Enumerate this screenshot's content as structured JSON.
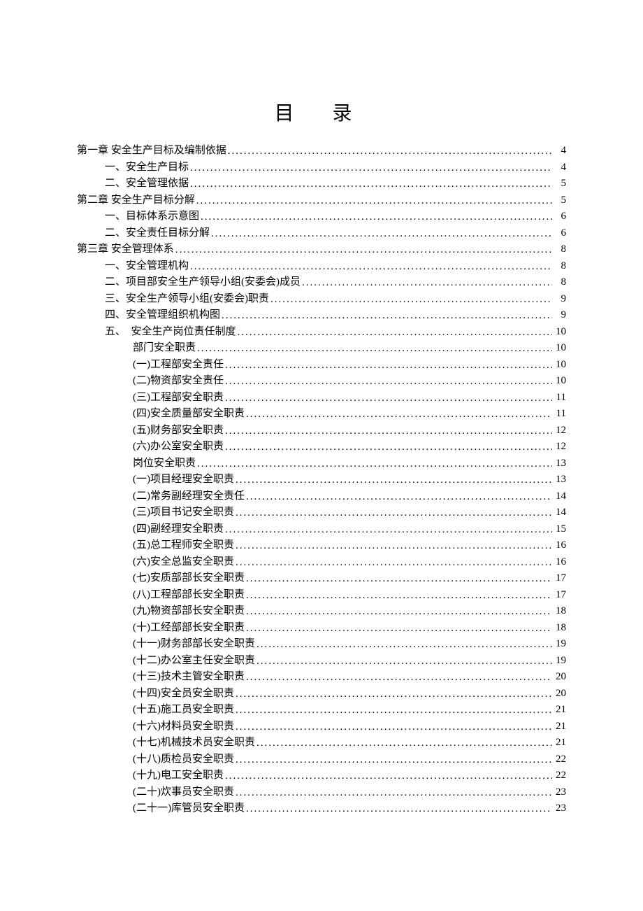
{
  "title": "目 录",
  "toc": [
    {
      "level": 0,
      "label": "第一章 安全生产目标及编制依据",
      "page": "4"
    },
    {
      "level": 1,
      "label": "一、安全生产目标",
      "page": "4"
    },
    {
      "level": 1,
      "label": "二、安全管理依据",
      "page": "5"
    },
    {
      "level": 0,
      "label": "第二章 安全生产目标分解",
      "page": "5"
    },
    {
      "level": 1,
      "label": "一、目标体系示意图",
      "page": "6"
    },
    {
      "level": 1,
      "label": "二、安全责任目标分解",
      "page": "6"
    },
    {
      "level": 0,
      "label": "第三章 安全管理体系",
      "page": "8"
    },
    {
      "level": 1,
      "label": "一、安全管理机构",
      "page": "8"
    },
    {
      "level": 1,
      "label": "二、项目部安全生产领导小组(安委会)成员",
      "page": "8"
    },
    {
      "level": 1,
      "label": "三、安全生产领导小组(安委会)职责",
      "page": "9"
    },
    {
      "level": 1,
      "label": "四、安全管理组织机构图",
      "page": "9"
    },
    {
      "level": 1,
      "label": "五、　安全生产岗位责任制度",
      "page": "10"
    },
    {
      "level": 2,
      "label": "部门安全职责",
      "page": "10"
    },
    {
      "level": 2,
      "label": "(一)工程部安全责任",
      "page": "10"
    },
    {
      "level": 2,
      "label": "(二)物资部安全责任",
      "page": "10"
    },
    {
      "level": 2,
      "label": "(三)工程部安全职责",
      "page": "11"
    },
    {
      "level": 2,
      "label": "(四)安全质量部安全职责",
      "page": "11"
    },
    {
      "level": 2,
      "label": "(五)财务部安全职责",
      "page": "12"
    },
    {
      "level": 2,
      "label": "(六)办公室安全职责",
      "page": "12"
    },
    {
      "level": 2,
      "label": "岗位安全职责",
      "page": "13"
    },
    {
      "level": 2,
      "label": "(一)项目经理安全职责",
      "page": "13"
    },
    {
      "level": 2,
      "label": "(二)常务副经理安全责任",
      "page": "14"
    },
    {
      "level": 2,
      "label": "(三)项目书记安全职责",
      "page": "14"
    },
    {
      "level": 2,
      "label": "(四)副经理安全职责",
      "page": "15"
    },
    {
      "level": 2,
      "label": "(五)总工程师安全职责",
      "page": "16"
    },
    {
      "level": 2,
      "label": "(六)安全总监安全职责",
      "page": "16"
    },
    {
      "level": 2,
      "label": "(七)安质部部长安全职责",
      "page": "17"
    },
    {
      "level": 2,
      "label": "(八)工程部部长安全职责",
      "page": "17"
    },
    {
      "level": 2,
      "label": "(九)物资部部长安全职责",
      "page": "18"
    },
    {
      "level": 2,
      "label": "(十)工经部部长安全职责",
      "page": "18"
    },
    {
      "level": 2,
      "label": "(十一)财务部部长安全职责",
      "page": "19"
    },
    {
      "level": 2,
      "label": "(十二)办公室主任安全职责",
      "page": "19"
    },
    {
      "level": 2,
      "label": "(十三)技术主管安全职责",
      "page": "20"
    },
    {
      "level": 2,
      "label": "(十四)安全员安全职责",
      "page": "20"
    },
    {
      "level": 2,
      "label": "(十五)施工员安全职责",
      "page": "21"
    },
    {
      "level": 2,
      "label": "(十六)材料员安全职责",
      "page": "21"
    },
    {
      "level": 2,
      "label": "(十七)机械技术员安全职责",
      "page": "21"
    },
    {
      "level": 2,
      "label": "(十八)质检员安全职责",
      "page": "22"
    },
    {
      "level": 2,
      "label": "(十九)电工安全职责",
      "page": "22"
    },
    {
      "level": 2,
      "label": "(二十)炊事员安全职责",
      "page": "23"
    },
    {
      "level": 2,
      "label": "(二十一)库管员安全职责",
      "page": "23"
    }
  ]
}
